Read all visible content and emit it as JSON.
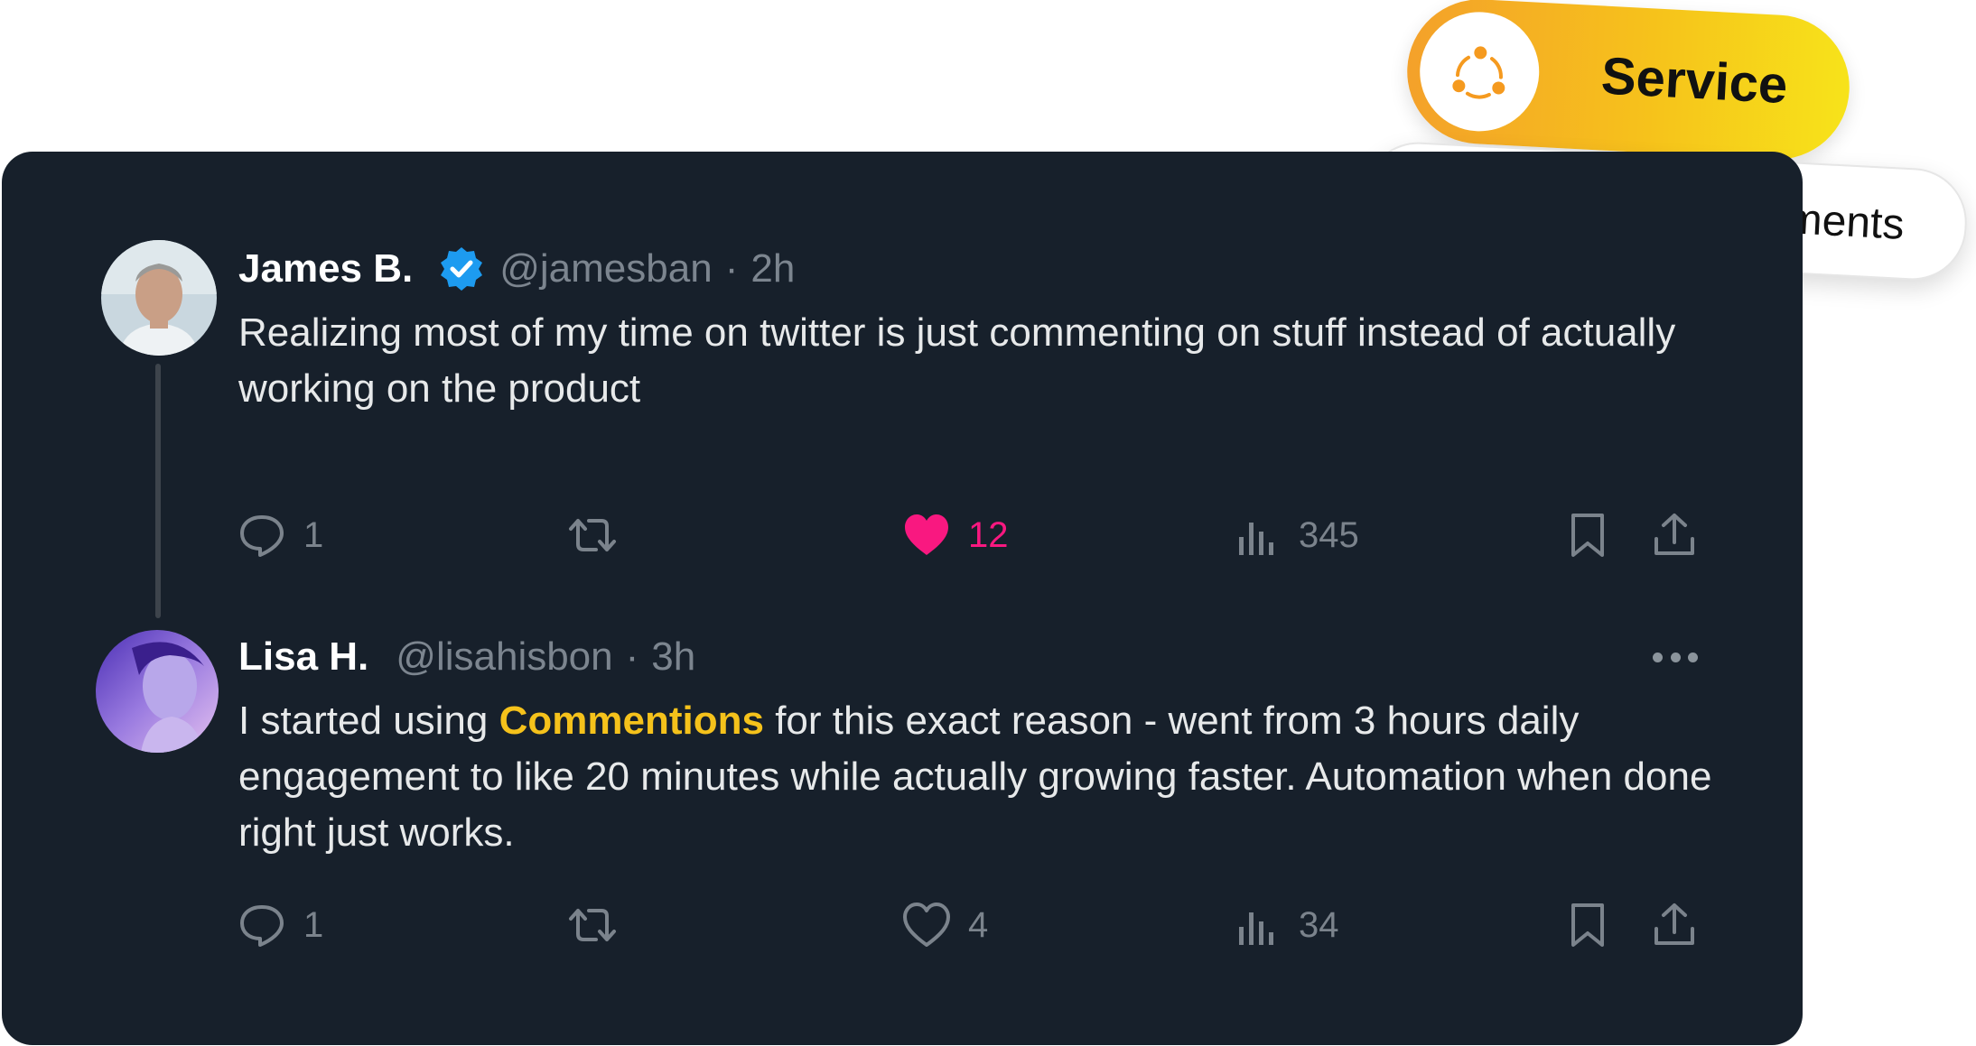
{
  "pills": {
    "service": {
      "label": "Service",
      "icon": "share-nodes-icon"
    },
    "automatic": {
      "label": "Automatic Comments",
      "icon": "lightning-bolt-icon"
    }
  },
  "posts": [
    {
      "name": "James B.",
      "verified": true,
      "handle": "@jamesban",
      "separator": "·",
      "time": "2h",
      "text": "Realizing most of my time on twitter is just commenting on stuff instead of actually working on the product",
      "actions": {
        "replies": "1",
        "likes": "12",
        "liked": true,
        "views": "345"
      }
    },
    {
      "name": "Lisa H.",
      "handle": "@lisahisbon",
      "separator": "·",
      "time": "3h",
      "text_before": "I started using ",
      "text_highlight": "Commentions",
      "text_after": " for this exact reason - went from 3 hours daily engagement to like 20 minutes while actually growing faster. Automation when done right just works.",
      "actions": {
        "replies": "1",
        "likes": "4",
        "liked": false,
        "views": "34"
      }
    }
  ],
  "colors": {
    "card_bg": "#17202b",
    "highlight": "#f5c21b",
    "like": "#f91880",
    "verified": "#1d9bf0"
  }
}
